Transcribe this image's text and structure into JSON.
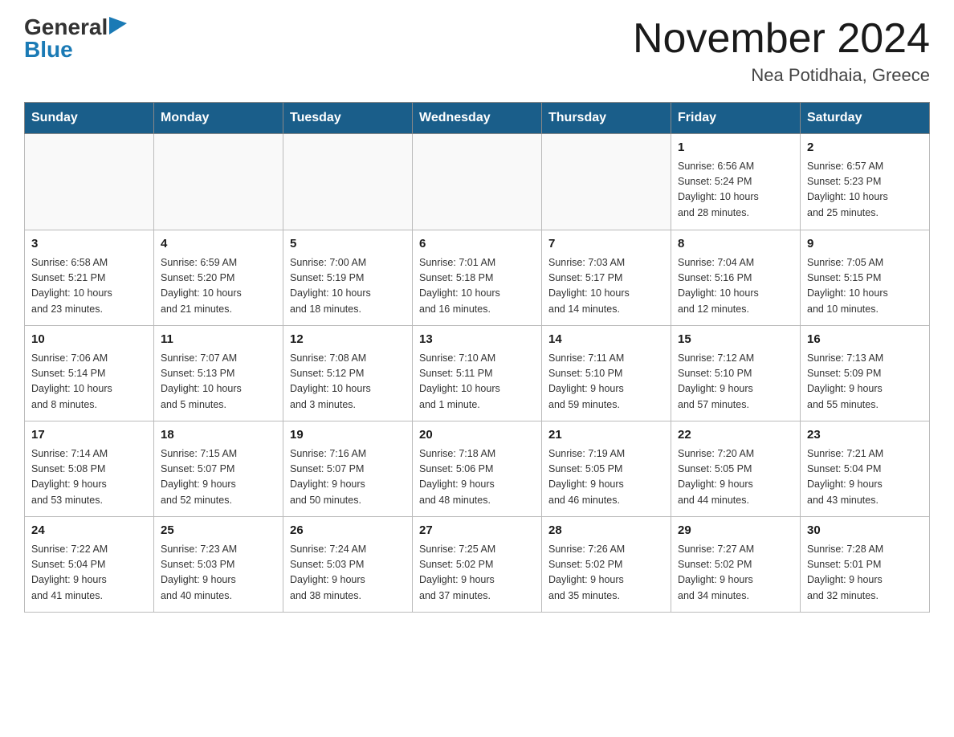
{
  "header": {
    "logo_general": "General",
    "logo_blue": "Blue",
    "month_title": "November 2024",
    "location": "Nea Potidhaia, Greece"
  },
  "weekdays": [
    "Sunday",
    "Monday",
    "Tuesday",
    "Wednesday",
    "Thursday",
    "Friday",
    "Saturday"
  ],
  "weeks": [
    [
      {
        "day": "",
        "info": ""
      },
      {
        "day": "",
        "info": ""
      },
      {
        "day": "",
        "info": ""
      },
      {
        "day": "",
        "info": ""
      },
      {
        "day": "",
        "info": ""
      },
      {
        "day": "1",
        "info": "Sunrise: 6:56 AM\nSunset: 5:24 PM\nDaylight: 10 hours\nand 28 minutes."
      },
      {
        "day": "2",
        "info": "Sunrise: 6:57 AM\nSunset: 5:23 PM\nDaylight: 10 hours\nand 25 minutes."
      }
    ],
    [
      {
        "day": "3",
        "info": "Sunrise: 6:58 AM\nSunset: 5:21 PM\nDaylight: 10 hours\nand 23 minutes."
      },
      {
        "day": "4",
        "info": "Sunrise: 6:59 AM\nSunset: 5:20 PM\nDaylight: 10 hours\nand 21 minutes."
      },
      {
        "day": "5",
        "info": "Sunrise: 7:00 AM\nSunset: 5:19 PM\nDaylight: 10 hours\nand 18 minutes."
      },
      {
        "day": "6",
        "info": "Sunrise: 7:01 AM\nSunset: 5:18 PM\nDaylight: 10 hours\nand 16 minutes."
      },
      {
        "day": "7",
        "info": "Sunrise: 7:03 AM\nSunset: 5:17 PM\nDaylight: 10 hours\nand 14 minutes."
      },
      {
        "day": "8",
        "info": "Sunrise: 7:04 AM\nSunset: 5:16 PM\nDaylight: 10 hours\nand 12 minutes."
      },
      {
        "day": "9",
        "info": "Sunrise: 7:05 AM\nSunset: 5:15 PM\nDaylight: 10 hours\nand 10 minutes."
      }
    ],
    [
      {
        "day": "10",
        "info": "Sunrise: 7:06 AM\nSunset: 5:14 PM\nDaylight: 10 hours\nand 8 minutes."
      },
      {
        "day": "11",
        "info": "Sunrise: 7:07 AM\nSunset: 5:13 PM\nDaylight: 10 hours\nand 5 minutes."
      },
      {
        "day": "12",
        "info": "Sunrise: 7:08 AM\nSunset: 5:12 PM\nDaylight: 10 hours\nand 3 minutes."
      },
      {
        "day": "13",
        "info": "Sunrise: 7:10 AM\nSunset: 5:11 PM\nDaylight: 10 hours\nand 1 minute."
      },
      {
        "day": "14",
        "info": "Sunrise: 7:11 AM\nSunset: 5:10 PM\nDaylight: 9 hours\nand 59 minutes."
      },
      {
        "day": "15",
        "info": "Sunrise: 7:12 AM\nSunset: 5:10 PM\nDaylight: 9 hours\nand 57 minutes."
      },
      {
        "day": "16",
        "info": "Sunrise: 7:13 AM\nSunset: 5:09 PM\nDaylight: 9 hours\nand 55 minutes."
      }
    ],
    [
      {
        "day": "17",
        "info": "Sunrise: 7:14 AM\nSunset: 5:08 PM\nDaylight: 9 hours\nand 53 minutes."
      },
      {
        "day": "18",
        "info": "Sunrise: 7:15 AM\nSunset: 5:07 PM\nDaylight: 9 hours\nand 52 minutes."
      },
      {
        "day": "19",
        "info": "Sunrise: 7:16 AM\nSunset: 5:07 PM\nDaylight: 9 hours\nand 50 minutes."
      },
      {
        "day": "20",
        "info": "Sunrise: 7:18 AM\nSunset: 5:06 PM\nDaylight: 9 hours\nand 48 minutes."
      },
      {
        "day": "21",
        "info": "Sunrise: 7:19 AM\nSunset: 5:05 PM\nDaylight: 9 hours\nand 46 minutes."
      },
      {
        "day": "22",
        "info": "Sunrise: 7:20 AM\nSunset: 5:05 PM\nDaylight: 9 hours\nand 44 minutes."
      },
      {
        "day": "23",
        "info": "Sunrise: 7:21 AM\nSunset: 5:04 PM\nDaylight: 9 hours\nand 43 minutes."
      }
    ],
    [
      {
        "day": "24",
        "info": "Sunrise: 7:22 AM\nSunset: 5:04 PM\nDaylight: 9 hours\nand 41 minutes."
      },
      {
        "day": "25",
        "info": "Sunrise: 7:23 AM\nSunset: 5:03 PM\nDaylight: 9 hours\nand 40 minutes."
      },
      {
        "day": "26",
        "info": "Sunrise: 7:24 AM\nSunset: 5:03 PM\nDaylight: 9 hours\nand 38 minutes."
      },
      {
        "day": "27",
        "info": "Sunrise: 7:25 AM\nSunset: 5:02 PM\nDaylight: 9 hours\nand 37 minutes."
      },
      {
        "day": "28",
        "info": "Sunrise: 7:26 AM\nSunset: 5:02 PM\nDaylight: 9 hours\nand 35 minutes."
      },
      {
        "day": "29",
        "info": "Sunrise: 7:27 AM\nSunset: 5:02 PM\nDaylight: 9 hours\nand 34 minutes."
      },
      {
        "day": "30",
        "info": "Sunrise: 7:28 AM\nSunset: 5:01 PM\nDaylight: 9 hours\nand 32 minutes."
      }
    ]
  ]
}
